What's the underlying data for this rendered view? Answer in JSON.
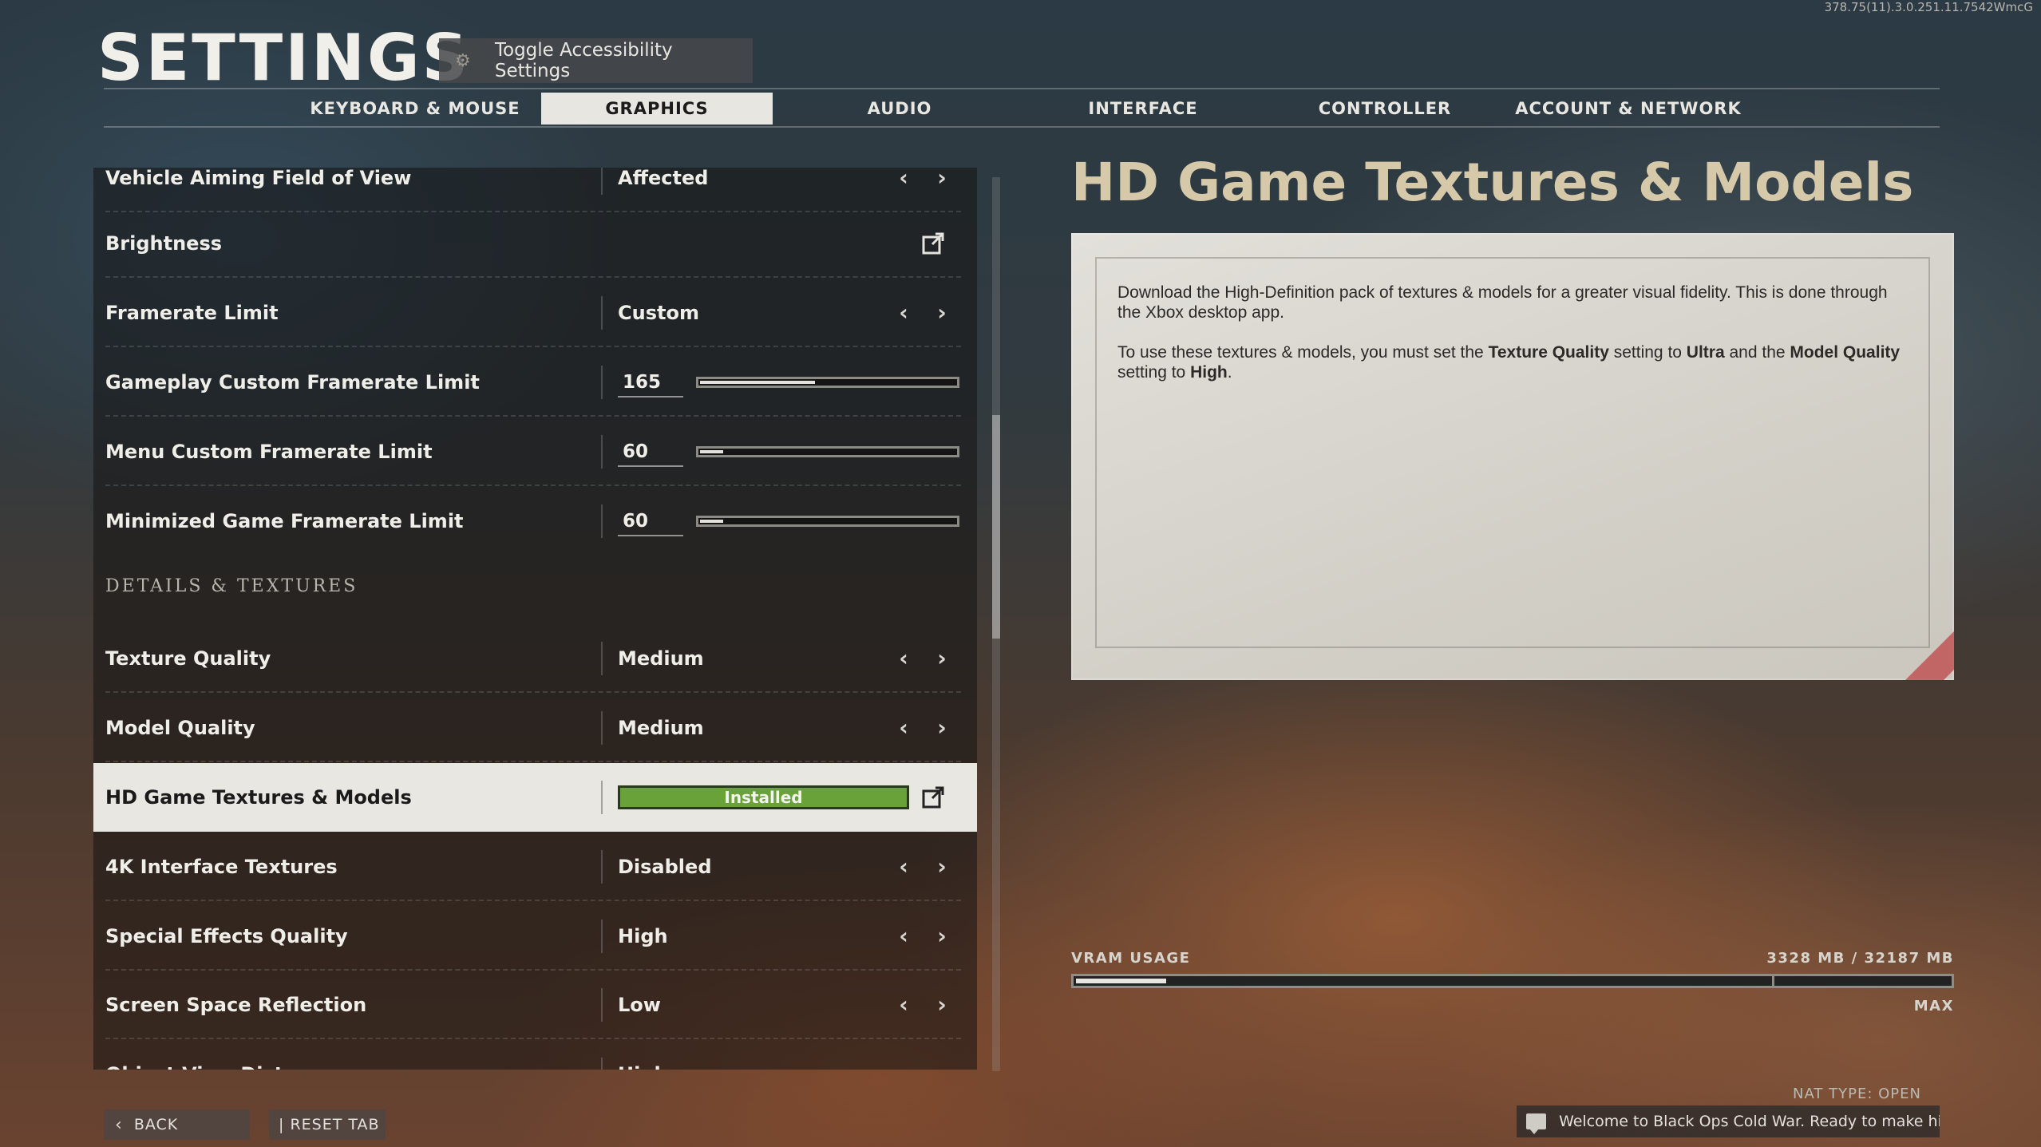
{
  "version_string": "378.75(11).3.0.251.11.7542WmcG",
  "header": {
    "title": "SETTINGS",
    "accessibility_button": "Toggle Accessibility Settings"
  },
  "tabs": [
    {
      "label": "KEYBOARD & MOUSE",
      "active": false
    },
    {
      "label": "GRAPHICS",
      "active": true
    },
    {
      "label": "AUDIO",
      "active": false
    },
    {
      "label": "INTERFACE",
      "active": false
    },
    {
      "label": "CONTROLLER",
      "active": false
    },
    {
      "label": "ACCOUNT & NETWORK",
      "active": false
    }
  ],
  "settings": {
    "vehicle_fov": {
      "label": "Vehicle Aiming Field of View",
      "value": "Affected"
    },
    "brightness": {
      "label": "Brightness"
    },
    "framerate_limit": {
      "label": "Framerate Limit",
      "value": "Custom"
    },
    "gameplay_fps": {
      "label": "Gameplay Custom Framerate Limit",
      "value": "165",
      "fraction": 0.45
    },
    "menu_fps": {
      "label": "Menu Custom Framerate Limit",
      "value": "60",
      "fraction": 0.09
    },
    "minimized_fps": {
      "label": "Minimized Game Framerate Limit",
      "value": "60",
      "fraction": 0.09
    },
    "section_details": "DETAILS & TEXTURES",
    "texture_quality": {
      "label": "Texture Quality",
      "value": "Medium"
    },
    "model_quality": {
      "label": "Model Quality",
      "value": "Medium"
    },
    "hd_textures": {
      "label": "HD Game Textures & Models",
      "value": "Installed"
    },
    "interface_4k": {
      "label": "4K Interface Textures",
      "value": "Disabled"
    },
    "special_effects": {
      "label": "Special Effects Quality",
      "value": "High"
    },
    "ssr": {
      "label": "Screen Space Reflection",
      "value": "Low"
    },
    "object_view": {
      "label": "Object View Distance",
      "value": "High"
    }
  },
  "detail": {
    "title": "HD Game Textures & Models",
    "para1": "Download the High-Definition pack of textures & models for a greater visual fidelity. This is done through the Xbox desktop app.",
    "para2_a": "To use these textures & models, you must set the ",
    "para2_b": "Texture Quality",
    "para2_c": " setting to ",
    "para2_d": "Ultra",
    "para2_e": " and the ",
    "para2_f": "Model Quality",
    "para2_g": " setting to ",
    "para2_h": "High",
    "para2_i": "."
  },
  "vram": {
    "label": "VRAM USAGE",
    "amount": "3328 MB / 32187 MB",
    "used_fraction": 0.1034,
    "max_label": "MAX"
  },
  "footer": {
    "nat_type": "NAT TYPE: OPEN",
    "chat_message": "Welcome to Black Ops Cold War. Ready to make histor...",
    "back_label": "BACK",
    "reset_label": "| RESET TAB"
  },
  "colors": {
    "installed_green": "#6aa23a",
    "title_tan": "#d6c9aa"
  }
}
